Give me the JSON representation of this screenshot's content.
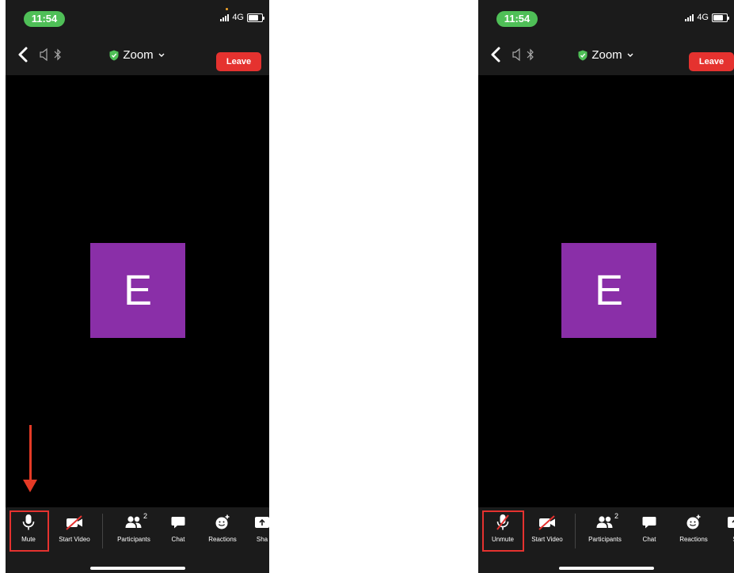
{
  "status": {
    "time": "11:54",
    "network": "4G"
  },
  "header": {
    "title": "Zoom",
    "leave_label": "Leave"
  },
  "avatar": {
    "initial": "E"
  },
  "left_toolbar": {
    "mute_label": "Mute",
    "start_video_label": "Start Video",
    "participants_label": "Participants",
    "participants_count": "2",
    "chat_label": "Chat",
    "reactions_label": "Reactions",
    "share_label": "Sha"
  },
  "right_toolbar": {
    "unmute_label": "Unmute",
    "start_video_label": "Start Video",
    "participants_label": "Participants",
    "participants_count": "2",
    "chat_label": "Chat",
    "reactions_label": "Reactions",
    "share_label": "S"
  },
  "colors": {
    "accent_red": "#e5322f",
    "time_green": "#4fbf57",
    "avatar_purple": "#8a2fa8",
    "shield_green": "#4fbf57"
  },
  "icons": [
    "back-icon",
    "speaker-icon",
    "bluetooth-icon",
    "shield-check-icon",
    "chevron-down-icon",
    "microphone-icon",
    "microphone-off-icon",
    "video-off-icon",
    "participants-icon",
    "chat-icon",
    "reactions-icon",
    "share-icon"
  ]
}
